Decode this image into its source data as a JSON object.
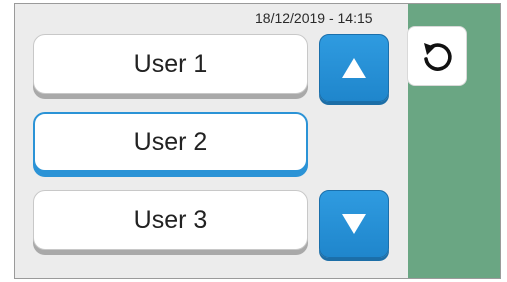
{
  "header": {
    "datetime": "18/12/2019 - 14:15"
  },
  "users": [
    {
      "label": "User 1"
    },
    {
      "label": "User 2",
      "selected": true
    },
    {
      "label": "User 3"
    }
  ],
  "controls": {
    "up_icon": "triangle-up-icon",
    "down_icon": "triangle-down-icon",
    "back_icon": "rotate-back-icon"
  },
  "colors": {
    "accent": "#2b93d6",
    "side_panel": "#6aa683",
    "main_bg": "#ececec"
  }
}
